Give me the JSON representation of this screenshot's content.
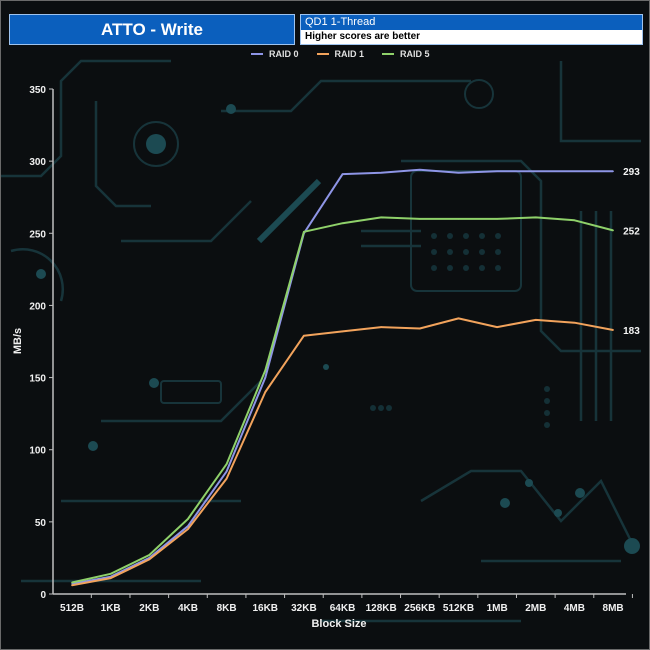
{
  "header": {
    "title": "ATTO - Write",
    "subtitle": "QD1 1-Thread",
    "note": "Higher scores are better"
  },
  "chart_data": {
    "type": "line",
    "title": "ATTO - Write",
    "subtitle": "QD1 1-Thread",
    "xlabel": "Block Size",
    "ylabel": "MB/s",
    "ylim": [
      0,
      350
    ],
    "yticks": [
      0,
      50,
      100,
      150,
      200,
      250,
      300,
      350
    ],
    "grid": false,
    "legend_position": "top-center",
    "categories": [
      "512B",
      "1KB",
      "2KB",
      "4KB",
      "8KB",
      "16KB",
      "32KB",
      "64KB",
      "128KB",
      "256KB",
      "512KB",
      "1MB",
      "2MB",
      "4MB",
      "8MB"
    ],
    "series": [
      {
        "name": "RAID 0",
        "color": "#8e95e6",
        "values": [
          7,
          12,
          25,
          47,
          85,
          150,
          250,
          291,
          292,
          294,
          292,
          293,
          293,
          293,
          293
        ],
        "end_label": "293"
      },
      {
        "name": "RAID 1",
        "color": "#f2a35c",
        "values": [
          6,
          11,
          24,
          45,
          80,
          140,
          179,
          182,
          185,
          184,
          191,
          185,
          190,
          188,
          183
        ],
        "end_label": "183"
      },
      {
        "name": "RAID 5",
        "color": "#8fd16a",
        "values": [
          8,
          14,
          27,
          52,
          90,
          155,
          251,
          257,
          261,
          260,
          260,
          260,
          261,
          259,
          252
        ],
        "end_label": "252"
      }
    ]
  }
}
